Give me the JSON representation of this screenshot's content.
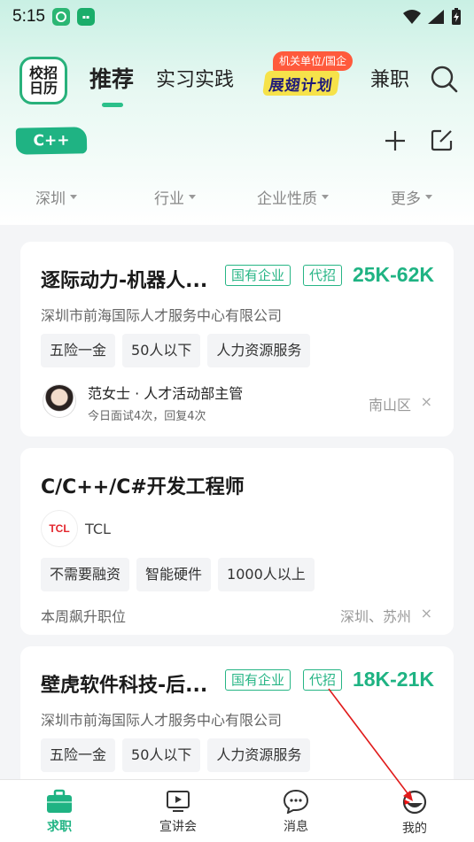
{
  "status_bar": {
    "time": "5:15"
  },
  "header": {
    "logo_text_line1": "校招",
    "logo_text_line2": "日历",
    "tabs": [
      {
        "label": "推荐",
        "active": true
      },
      {
        "label": "实习实践",
        "active": false
      },
      {
        "label": "兼职",
        "active": false
      }
    ],
    "promo_badge": "机关单位/国企",
    "promo_label": "展翅计划"
  },
  "filter_tag": "C++",
  "filters": [
    "深圳",
    "行业",
    "企业性质",
    "更多"
  ],
  "jobs": [
    {
      "title": "逐际动力-机器人...",
      "badges": [
        "国有企业",
        "代招"
      ],
      "salary": "25K-62K",
      "company": "深圳市前海国际人才服务中心有限公司",
      "tags": [
        "五险一金",
        "50人以下",
        "人力资源服务"
      ],
      "recruiter_name": "范女士 · 人才活动部主管",
      "recruiter_stat": "今日面试4次，回复4次",
      "location": "南山区"
    },
    {
      "title": "C/C++/C#开发工程师",
      "company_logo_text": "TCL",
      "company": "TCL",
      "tags": [
        "不需要融资",
        "智能硬件",
        "1000人以上"
      ],
      "note": "本周飙升职位",
      "location": "深圳、苏州"
    },
    {
      "title": "壁虎软件科技-后...",
      "badges": [
        "国有企业",
        "代招"
      ],
      "salary": "18K-21K",
      "company": "深圳市前海国际人才服务中心有限公司",
      "tags": [
        "五险一金",
        "50人以下",
        "人力资源服务"
      ]
    }
  ],
  "bottom_nav": [
    {
      "label": "求职",
      "icon": "briefcase-icon",
      "active": true
    },
    {
      "label": "宣讲会",
      "icon": "play-screen-icon",
      "active": false
    },
    {
      "label": "消息",
      "icon": "chat-bubble-icon",
      "active": false
    },
    {
      "label": "我的",
      "icon": "profile-icon",
      "active": false
    }
  ],
  "dismiss_glyph": "×",
  "colors": {
    "accent": "#1fb383",
    "promo": "#f6e24a",
    "badge_red": "#ff5a3c"
  }
}
